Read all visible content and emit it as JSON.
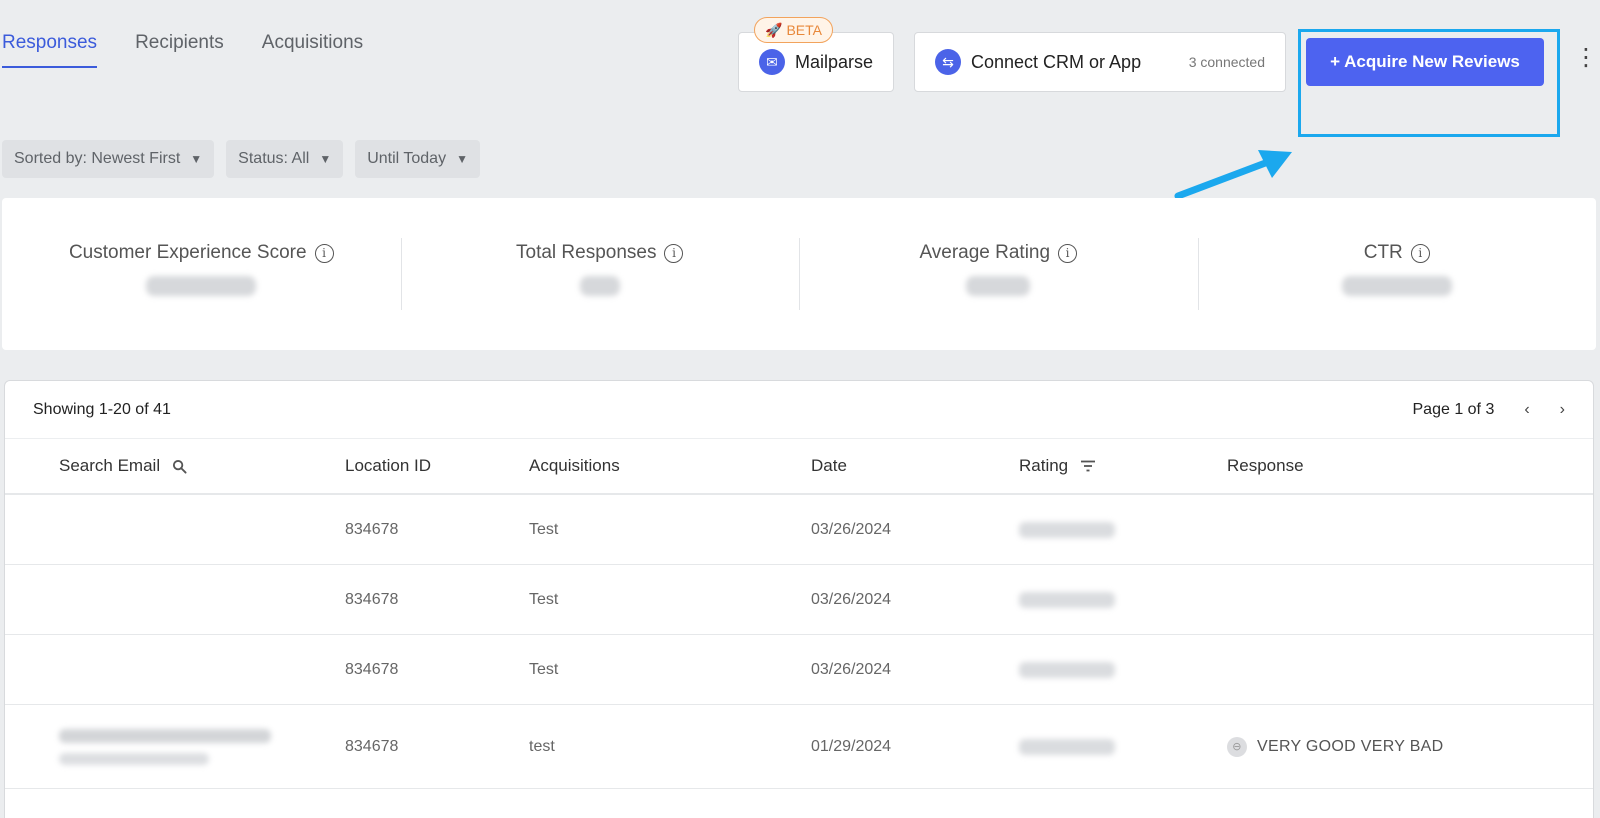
{
  "tabs": [
    {
      "label": "Responses",
      "active": true
    },
    {
      "label": "Recipients",
      "active": false
    },
    {
      "label": "Acquisitions",
      "active": false
    }
  ],
  "header": {
    "beta_badge": "BETA",
    "mailparse_label": "Mailparse",
    "crm_label": "Connect CRM or App",
    "crm_connected": "3 connected",
    "acquire_label": "+ Acquire New Reviews"
  },
  "filters": {
    "sort": "Sorted by: Newest First",
    "status": "Status: All",
    "date": "Until Today"
  },
  "stats": [
    {
      "label": "Customer Experience Score"
    },
    {
      "label": "Total Responses"
    },
    {
      "label": "Average Rating"
    },
    {
      "label": "CTR"
    }
  ],
  "table": {
    "showing": "Showing 1-20 of 41",
    "page": "Page 1 of 3",
    "columns": [
      "Search Email",
      "Location ID",
      "Acquisitions",
      "Date",
      "Rating",
      "Response"
    ],
    "rows": [
      {
        "location_id": "834678",
        "acquisition": "Test",
        "date": "03/26/2024",
        "response": ""
      },
      {
        "location_id": "834678",
        "acquisition": "Test",
        "date": "03/26/2024",
        "response": ""
      },
      {
        "location_id": "834678",
        "acquisition": "Test",
        "date": "03/26/2024",
        "response": ""
      },
      {
        "location_id": "834678",
        "acquisition": "test",
        "date": "01/29/2024",
        "response": "VERY GOOD VERY BAD"
      }
    ]
  },
  "colors": {
    "accent": "#4d63f0",
    "highlight": "#1ba8ee",
    "beta": "#e8883a"
  }
}
